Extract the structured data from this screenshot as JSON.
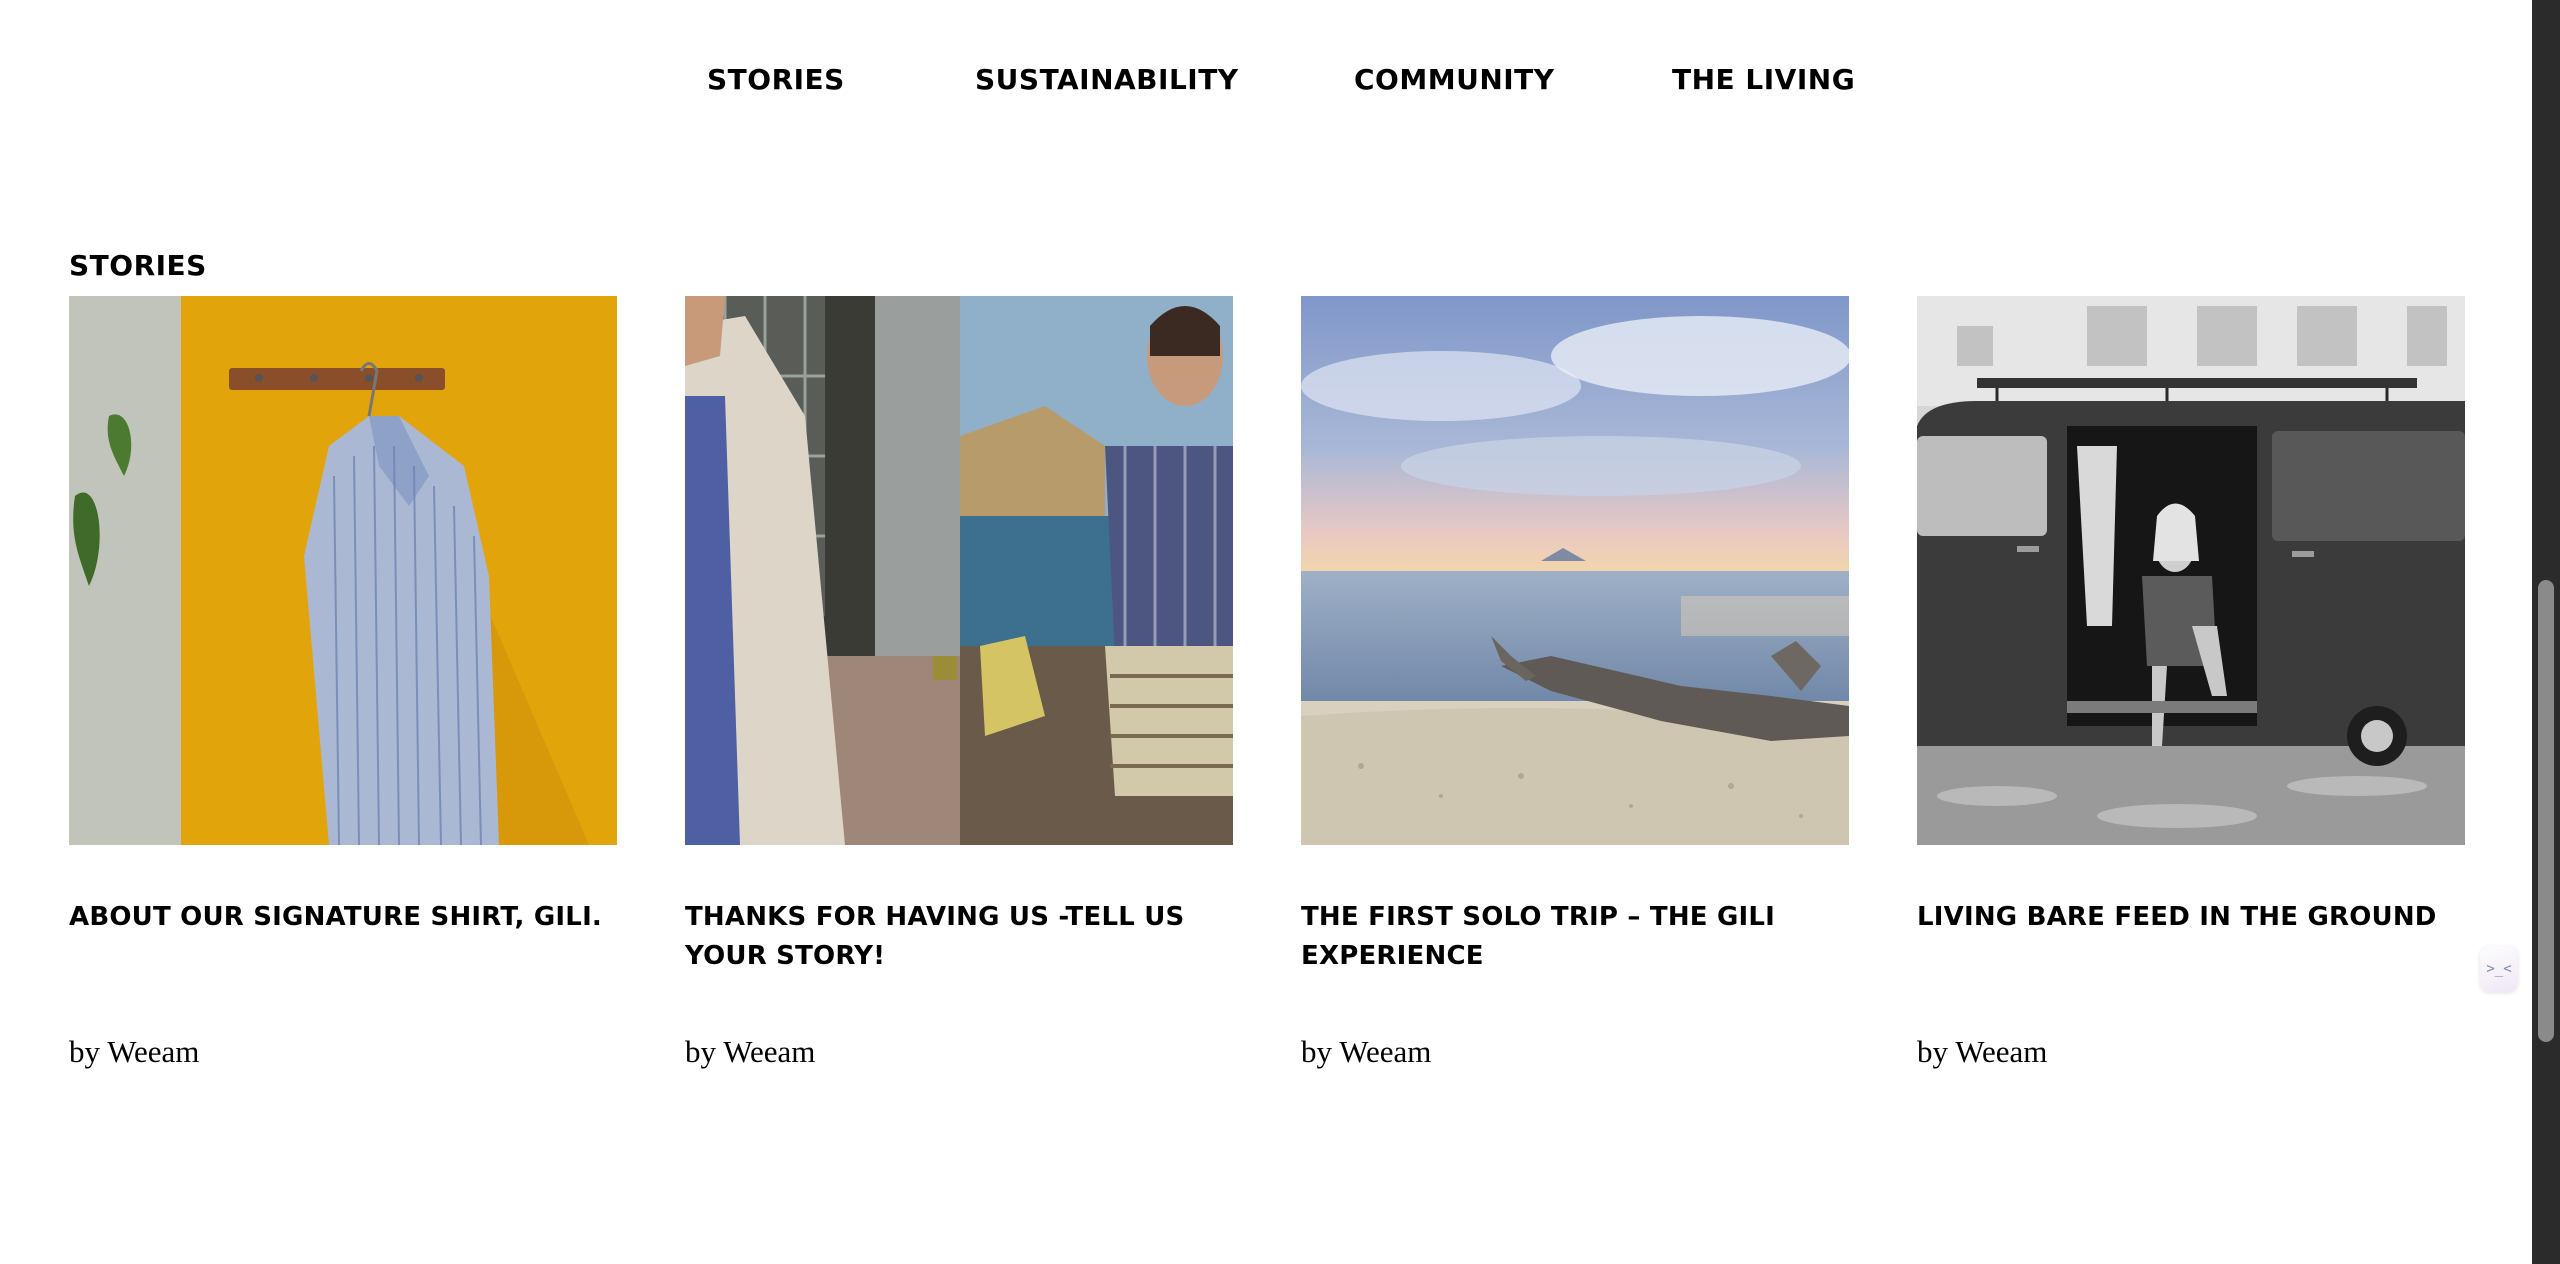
{
  "nav": {
    "items": [
      {
        "label": "STORIES"
      },
      {
        "label": "SUSTAINABILITY"
      },
      {
        "label": "COMMUNITY"
      },
      {
        "label": "THE LIVING"
      }
    ]
  },
  "section": {
    "title": "STORIES"
  },
  "cards": [
    {
      "title": "ABOUT OUR SIGNATURE SHIRT, GILI.",
      "author": "by Weeam"
    },
    {
      "title": "THANKS FOR HAVING US -TELL US YOUR STORY!",
      "author": "by Weeam"
    },
    {
      "title": "THE FIRST SOLO TRIP – THE GILI EXPERIENCE",
      "author": "by Weeam"
    },
    {
      "title": "LIVING BARE FEED IN THE GROUND",
      "author": "by Weeam"
    }
  ],
  "assistant": {
    "icon": "chat-assistant-icon",
    "glyph": ">_<"
  },
  "colors": {
    "background": "#ffffff",
    "text": "#000000",
    "scrollbar_track": "#2b2b2b",
    "scrollbar_thumb": "#8a8a8a",
    "shirt_wall_yellow": "#e2a40b"
  }
}
